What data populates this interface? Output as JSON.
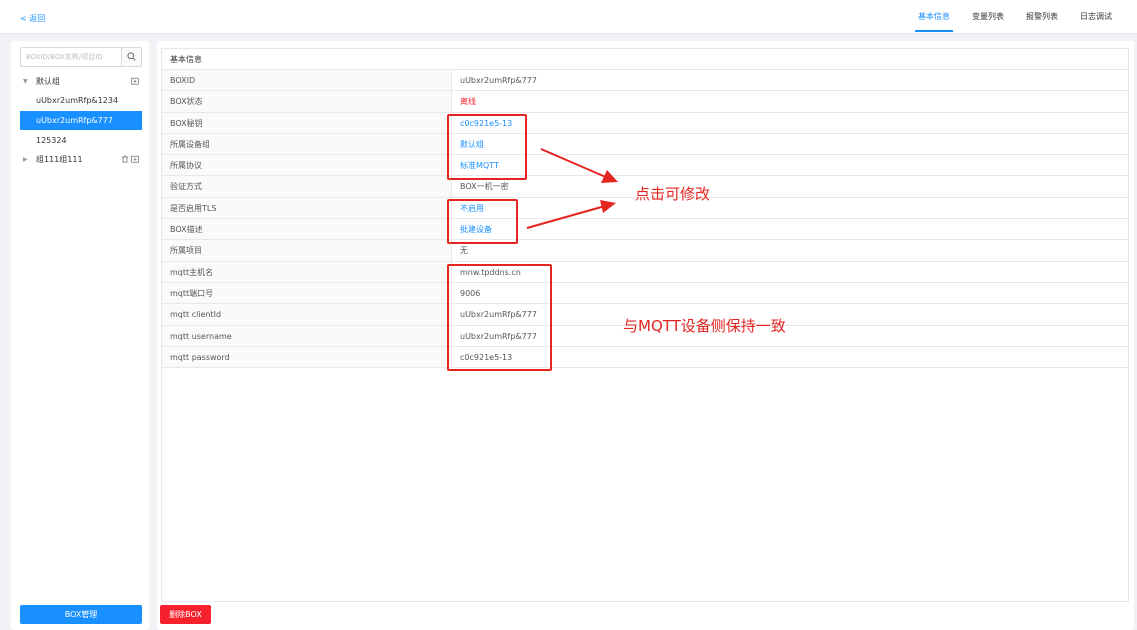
{
  "header": {
    "back_label": "< 返回",
    "tabs": [
      {
        "label": "基本信息",
        "active": true
      },
      {
        "label": "变量列表",
        "active": false
      },
      {
        "label": "报警列表",
        "active": false
      },
      {
        "label": "日志调试",
        "active": false
      }
    ]
  },
  "sidebar": {
    "search_placeholder": "BOXID/BOX名称/项目ID",
    "search_icon": "search-icon",
    "tree": [
      {
        "label": "默认组",
        "type": "group",
        "expanded": true
      },
      {
        "label": "uUbxr2umRfp&1234",
        "type": "device"
      },
      {
        "label": "uUbxr2umRfp&777",
        "type": "device",
        "selected": true
      },
      {
        "label": "125324",
        "type": "device"
      },
      {
        "label": "组111组111",
        "type": "group",
        "expanded": false
      }
    ],
    "manage_button": "BOX管理"
  },
  "main": {
    "panel_title": "基本信息",
    "rows": [
      {
        "key": "BOXID",
        "value": "uUbxr2umRfp&777",
        "style": "plain"
      },
      {
        "key": "BOX状态",
        "value": "离线",
        "style": "red"
      },
      {
        "key": "BOX秘钥",
        "value": "c0c921e5-13",
        "style": "link"
      },
      {
        "key": "所属设备组",
        "value": "默认组",
        "style": "link"
      },
      {
        "key": "所属协议",
        "value": "标准MQTT",
        "style": "link"
      },
      {
        "key": "验证方式",
        "value": "BOX一机一密",
        "style": "plain"
      },
      {
        "key": "是否启用TLS",
        "value": "不启用",
        "style": "link"
      },
      {
        "key": "BOX描述",
        "value": "批建设备",
        "style": "link"
      },
      {
        "key": "所属项目",
        "value": "无",
        "style": "plain"
      },
      {
        "key": "mqtt主机名",
        "value": "mnw.tpddns.cn",
        "style": "plain"
      },
      {
        "key": "mqtt端口号",
        "value": "9006",
        "style": "plain"
      },
      {
        "key": "mqtt clientId",
        "value": "uUbxr2umRfp&777",
        "style": "plain"
      },
      {
        "key": "mqtt username",
        "value": "uUbxr2umRfp&777",
        "style": "plain"
      },
      {
        "key": "mqtt password",
        "value": "c0c921e5-13",
        "style": "plain"
      }
    ],
    "delete_button": "删除BOX"
  },
  "annotations": {
    "color": "#e52520",
    "editable_note": "点击可修改",
    "mqtt_note": "与MQTT设备侧保持一致"
  },
  "colors": {
    "accent": "#1890ff",
    "danger": "#f5222d",
    "background": "#f0f2f5"
  }
}
